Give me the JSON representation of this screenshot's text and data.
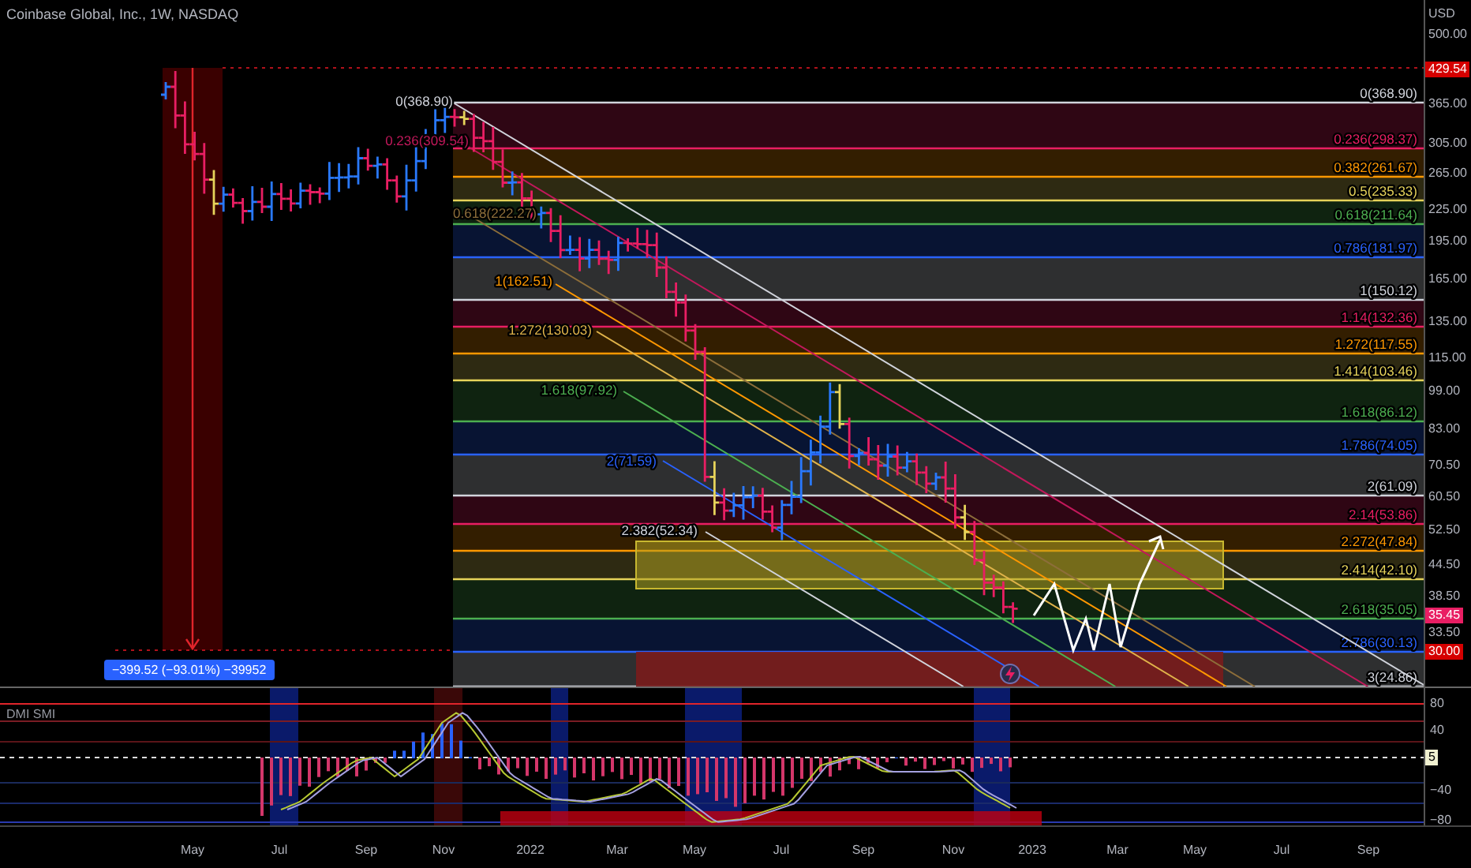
{
  "chart": {
    "title": "Coinbase Global, Inc., 1W, NASDAQ",
    "measure_label": "−399.52 (−93.01%) −39952",
    "fib_levels": [
      {
        "label": "0(368.90)",
        "color": "#d1d4dc"
      },
      {
        "label": "0.236(298.37)",
        "color": "#e91e63"
      },
      {
        "label": "0.382(261.67)",
        "color": "#ff9800"
      },
      {
        "label": "0.5(235.33)",
        "color": "#e6d35a"
      },
      {
        "label": "0.618(211.64)",
        "color": "#4caf50"
      },
      {
        "label": "0.786(181.97)",
        "color": "#2962ff"
      },
      {
        "label": "1(150.12)",
        "color": "#d1d4dc"
      },
      {
        "label": "1.14(132.36)",
        "color": "#e91e63"
      },
      {
        "label": "1.272(117.55)",
        "color": "#ff9800"
      },
      {
        "label": "1.414(103.46)",
        "color": "#e6d35a"
      },
      {
        "label": "1.618(86.12)",
        "color": "#4caf50"
      },
      {
        "label": "1.786(74.05)",
        "color": "#2962ff"
      },
      {
        "label": "2(61.09)",
        "color": "#d1d4dc"
      },
      {
        "label": "2.14(53.86)",
        "color": "#e91e63"
      },
      {
        "label": "2.272(47.84)",
        "color": "#ff9800"
      },
      {
        "label": "2.414(42.10)",
        "color": "#e6d35a"
      },
      {
        "label": "2.618(35.05)",
        "color": "#4caf50"
      },
      {
        "label": "2.786(30.13)",
        "color": "#2962ff"
      },
      {
        "label": "3(24.86)",
        "color": "#d1d4dc"
      }
    ],
    "channel_labels": [
      {
        "label": "0(368.90)",
        "color": "#d1d4dc"
      },
      {
        "label": "0.236(309.54)",
        "color": "#c2185b"
      },
      {
        "label": "0.618(222.27)",
        "color": "#8d6e3a"
      },
      {
        "label": "1(162.51)",
        "color": "#ff9800"
      },
      {
        "label": "1.272(130.03)",
        "color": "#e0b34a"
      },
      {
        "label": "1.618(97.92)",
        "color": "#4caf50"
      },
      {
        "label": "2(71.59)",
        "color": "#2962ff"
      },
      {
        "label": "2.382(52.34)",
        "color": "#d1d4dc"
      }
    ],
    "price_axis": {
      "unit": "USD",
      "labels": [
        "500.00",
        "365.00",
        "305.00",
        "265.00",
        "225.00",
        "195.00",
        "165.00",
        "135.00",
        "115.00",
        "99.00",
        "83.00",
        "70.50",
        "60.50",
        "52.50",
        "44.50",
        "38.50",
        "33.50"
      ],
      "tags": [
        {
          "text": "429.54",
          "color": "#d50000"
        },
        {
          "text": "35.45",
          "color": "#e91e63"
        },
        {
          "text": "30.00",
          "color": "#d50000"
        }
      ]
    }
  },
  "indicator": {
    "name": "DMI SMI",
    "axis_labels": [
      "80",
      "40",
      "−40",
      "−80"
    ],
    "tag": "5"
  },
  "time_axis": [
    "May",
    "Jul",
    "Sep",
    "Nov",
    "2022",
    "Mar",
    "May",
    "Jul",
    "Sep",
    "Nov",
    "2023",
    "Mar",
    "May",
    "Jul",
    "Sep"
  ]
}
